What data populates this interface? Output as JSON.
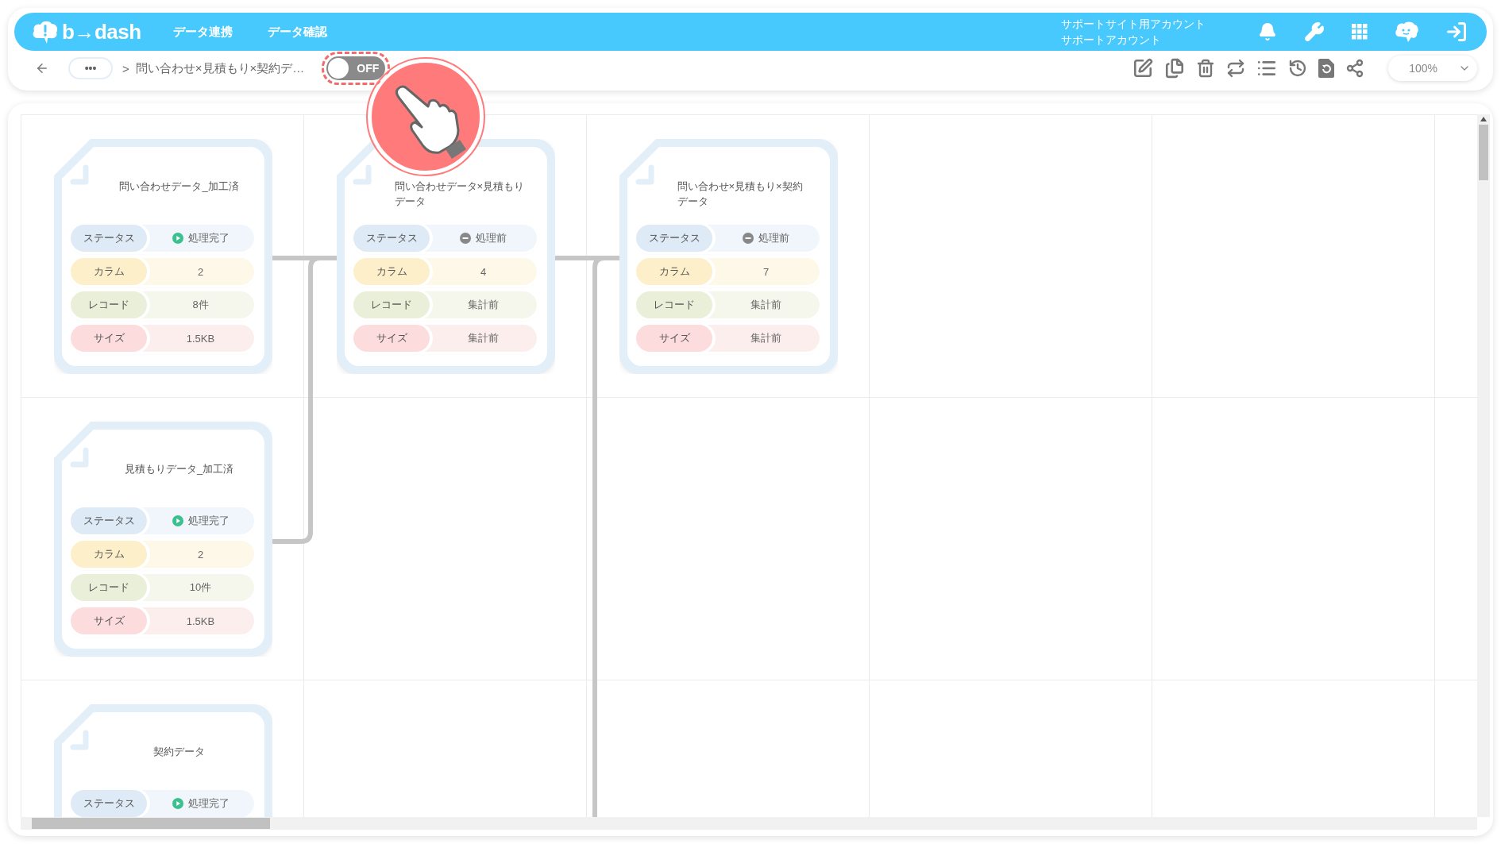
{
  "header": {
    "logo": "b→dash",
    "menu": [
      {
        "label": "データ連携"
      },
      {
        "label": "データ確認"
      }
    ],
    "account": {
      "line_1": "サポートサイト用アカウント",
      "line_2": "サポートアカウント"
    }
  },
  "toolbar": {
    "more": "•••",
    "separator": ">",
    "breadcrumb": "問い合わせ×見積もり×契約デ…",
    "toggle": {
      "label": "OFF",
      "on": false
    },
    "zoom": "100%"
  },
  "canvas": {
    "rows": [
      {
        "nodes": [
          {
            "title": "問い合わせデータ_加工済",
            "fields": [
              {
                "kind": "status",
                "label": "ステータス",
                "value": "処理完了",
                "done": true
              },
              {
                "kind": "column",
                "label": "カラム",
                "value": "2"
              },
              {
                "kind": "record",
                "label": "レコード",
                "value": "8件"
              },
              {
                "kind": "size",
                "label": "サイズ",
                "value": "1.5KB"
              }
            ]
          },
          {
            "title": "問い合わせデータ×見積もりデータ",
            "fields": [
              {
                "kind": "status",
                "label": "ステータス",
                "value": "処理前",
                "done": false
              },
              {
                "kind": "column",
                "label": "カラム",
                "value": "4"
              },
              {
                "kind": "record",
                "label": "レコード",
                "value": "集計前"
              },
              {
                "kind": "size",
                "label": "サイズ",
                "value": "集計前"
              }
            ]
          },
          {
            "title": "問い合わせ×見積もり×契約データ",
            "fields": [
              {
                "kind": "status",
                "label": "ステータス",
                "value": "処理前",
                "done": false
              },
              {
                "kind": "column",
                "label": "カラム",
                "value": "7"
              },
              {
                "kind": "record",
                "label": "レコード",
                "value": "集計前"
              },
              {
                "kind": "size",
                "label": "サイズ",
                "value": "集計前"
              }
            ]
          }
        ]
      },
      {
        "nodes": [
          {
            "title": "見積もりデータ_加工済",
            "fields": [
              {
                "kind": "status",
                "label": "ステータス",
                "value": "処理完了",
                "done": true
              },
              {
                "kind": "column",
                "label": "カラム",
                "value": "2"
              },
              {
                "kind": "record",
                "label": "レコード",
                "value": "10件"
              },
              {
                "kind": "size",
                "label": "サイズ",
                "value": "1.5KB"
              }
            ]
          }
        ]
      },
      {
        "nodes": [
          {
            "title": "契約データ",
            "fields": [
              {
                "kind": "status",
                "label": "ステータス",
                "value": "処理完了",
                "done": true
              }
            ]
          }
        ]
      }
    ]
  }
}
